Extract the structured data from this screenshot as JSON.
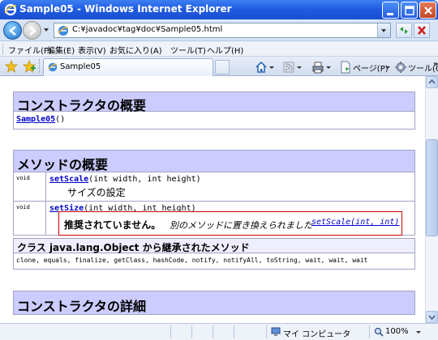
{
  "window": {
    "title": "Sample05 - Windows Internet Explorer"
  },
  "address": {
    "url": "C:¥javadoc¥tag¥doc¥Sample05.html"
  },
  "menu": {
    "items": [
      "ファイル(F)",
      "編集(E)",
      "表示(V)",
      "お気に入り(A)",
      "ツール(T)",
      "ヘルプ(H)"
    ]
  },
  "tabs": {
    "active_label": "Sample05"
  },
  "toolbar": {
    "page_label": "ページ(P)",
    "tools_label": "ツール(O)",
    "chevron": "»"
  },
  "content": {
    "constructor_summary": {
      "title": "コンストラクタの概要",
      "link": "Sample05",
      "args": "()"
    },
    "method_summary": {
      "title": "メソッドの概要",
      "rows": [
        {
          "modifier": "void",
          "name": "setScale",
          "params": "(int width, int height)",
          "description": "サイズの設定"
        },
        {
          "modifier": "void",
          "name": "setSize",
          "params": "(int width, int height)"
        }
      ],
      "deprecated": {
        "strong": "推奨されていません。",
        "text": "別のメソッドに置き換えられました",
        "link": "setScale(int, int)"
      }
    },
    "inherited": {
      "title": "クラス java.lang.Object から継承されたメソッド",
      "methods": "clone, equals, finalize, getClass, hashCode, notify, notifyAll, toString, wait, wait, wait"
    },
    "constructor_detail": {
      "title": "コンストラクタの詳細"
    }
  },
  "status": {
    "zone": "マイ コンピュータ",
    "zoom": "100%"
  }
}
